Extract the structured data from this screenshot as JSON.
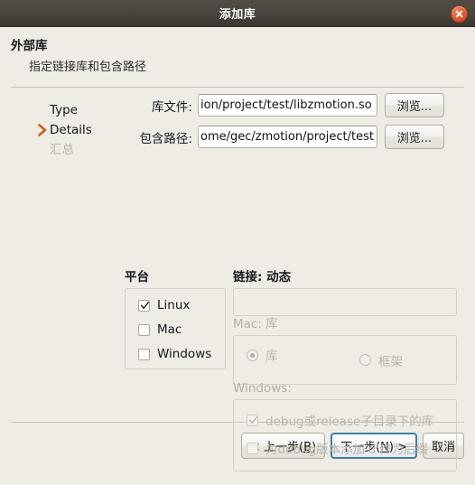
{
  "titlebar": {
    "title": "添加库",
    "close_icon": "close-icon"
  },
  "header": {
    "title": "外部库",
    "subtitle": "指定链接库和包含路径"
  },
  "sidebar": {
    "items": [
      {
        "label": "Type",
        "state": "normal"
      },
      {
        "label": "Details",
        "state": "current"
      },
      {
        "label": "汇总",
        "state": "disabled"
      }
    ],
    "current_marker_icon": "chevron-right-icon"
  },
  "form": {
    "fields": [
      {
        "label": "库文件:",
        "value": "ion/project/test/libzmotion.so",
        "placeholder": "",
        "browse_label": "浏览..."
      },
      {
        "label": "包含路径:",
        "value": "ome/gec/zmotion/project/test",
        "placeholder": "",
        "browse_label": "浏览..."
      }
    ]
  },
  "platform_group": {
    "title": "平台",
    "options": [
      {
        "label": "Linux",
        "checked": true
      },
      {
        "label": "Mac",
        "checked": false
      },
      {
        "label": "Windows",
        "checked": false
      }
    ]
  },
  "link_group": {
    "title": "链接: 动态"
  },
  "mac_group": {
    "title": "Mac: 库",
    "disabled": true,
    "options": [
      {
        "label": "库",
        "selected": true
      },
      {
        "label": "框架",
        "selected": false
      }
    ]
  },
  "windows_group": {
    "title": "Windows:",
    "disabled": true,
    "options": [
      {
        "label": "debug或release子目录下的库",
        "checked": true
      },
      {
        "label": "为debug版本添加'd'作为后缀",
        "checked": false
      }
    ]
  },
  "footer": {
    "back_label": "< 上一步(B)",
    "back_mnemonic": "B",
    "next_label": "下一步(N) >",
    "next_mnemonic": "N",
    "cancel_label": "取消"
  },
  "colors": {
    "titlebar": "#4a453f",
    "dialog_bg": "#efece6",
    "accent_chevron": "#d8601f",
    "close_button": "#e0603a",
    "default_button_border": "#3b7fa6",
    "disabled_text": "#b4b0a8"
  }
}
